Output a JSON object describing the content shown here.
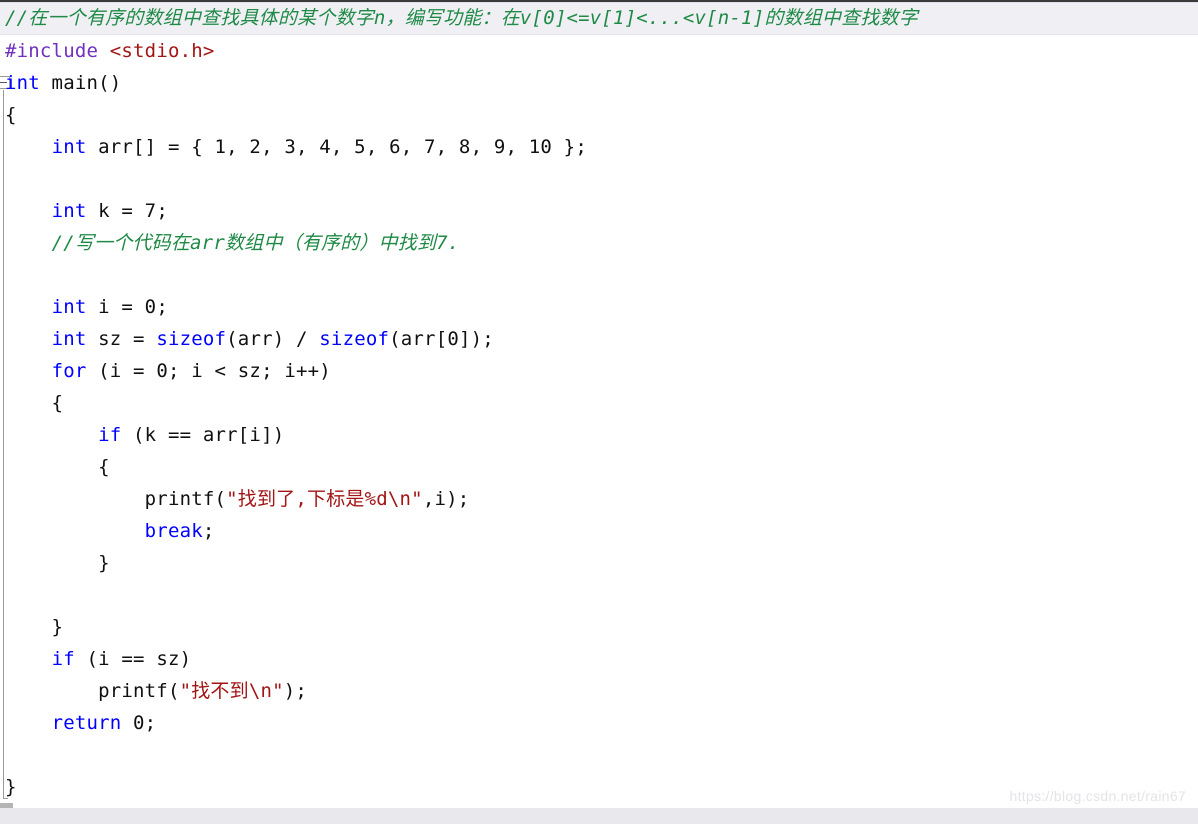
{
  "app": {
    "type": "code-editor",
    "language": "C",
    "watermark": "https://blog.csdn.net/rain67"
  },
  "colors": {
    "background": "#ffffff",
    "text": "#101010",
    "keyword": "#0000ff",
    "preprocessor": "#7030c0",
    "header": "#a31515",
    "string": "#a31515",
    "comment": "#1f8a46",
    "highlight_line": "#f0f0f4",
    "bottom_strip": "#e8e8ed",
    "watermark": "#e4e4e8"
  },
  "gutter": {
    "fold_box_icon": "collapse-minus-icon",
    "fold_box_line_index": 2
  },
  "code": {
    "lines": [
      {
        "i": 0,
        "highlight": true,
        "text": "//在一个有序的数组中查找具体的某个数字n，编写功能：在v[0]<=v[1]<...<v[n-1]的数组中查找数字",
        "tokens": [
          {
            "t": "//在一个有序的数组中查找具体的某个数字n，编写功能：在v[0]<=v[1]<...<v[n-1]的数组中查找数字",
            "c": "cmt"
          }
        ]
      },
      {
        "i": 1,
        "highlight": false,
        "text": "#include <stdio.h>",
        "tokens": [
          {
            "t": "#include ",
            "c": "pre"
          },
          {
            "t": "<stdio.h>",
            "c": "hdr"
          }
        ]
      },
      {
        "i": 2,
        "highlight": false,
        "text": "int main()",
        "tokens": [
          {
            "t": "int",
            "c": "kw"
          },
          {
            "t": " main()",
            "c": "pun"
          }
        ]
      },
      {
        "i": 3,
        "highlight": false,
        "text": "{",
        "tokens": [
          {
            "t": "{",
            "c": "pun"
          }
        ]
      },
      {
        "i": 4,
        "highlight": false,
        "text": "    int arr[] = { 1, 2, 3, 4, 5, 6, 7, 8, 9, 10 };",
        "tokens": [
          {
            "t": "    ",
            "c": "pun"
          },
          {
            "t": "int",
            "c": "kw"
          },
          {
            "t": " arr[] = { 1, 2, 3, 4, 5, 6, 7, 8, 9, 10 };",
            "c": "pun"
          }
        ]
      },
      {
        "i": 5,
        "highlight": false,
        "text": "",
        "tokens": []
      },
      {
        "i": 6,
        "highlight": false,
        "text": "    int k = 7;",
        "tokens": [
          {
            "t": "    ",
            "c": "pun"
          },
          {
            "t": "int",
            "c": "kw"
          },
          {
            "t": " k = 7;",
            "c": "pun"
          }
        ]
      },
      {
        "i": 7,
        "highlight": false,
        "text": "    //写一个代码在arr数组中（有序的）中找到7.",
        "tokens": [
          {
            "t": "    ",
            "c": "pun"
          },
          {
            "t": "//写一个代码在arr数组中（有序的）中找到7.",
            "c": "cmt"
          }
        ]
      },
      {
        "i": 8,
        "highlight": false,
        "text": "",
        "tokens": []
      },
      {
        "i": 9,
        "highlight": false,
        "text": "    int i = 0;",
        "tokens": [
          {
            "t": "    ",
            "c": "pun"
          },
          {
            "t": "int",
            "c": "kw"
          },
          {
            "t": " i = 0;",
            "c": "pun"
          }
        ]
      },
      {
        "i": 10,
        "highlight": false,
        "text": "    int sz = sizeof(arr) / sizeof(arr[0]);",
        "tokens": [
          {
            "t": "    ",
            "c": "pun"
          },
          {
            "t": "int",
            "c": "kw"
          },
          {
            "t": " sz = ",
            "c": "pun"
          },
          {
            "t": "sizeof",
            "c": "kw"
          },
          {
            "t": "(arr) / ",
            "c": "pun"
          },
          {
            "t": "sizeof",
            "c": "kw"
          },
          {
            "t": "(arr[0]);",
            "c": "pun"
          }
        ]
      },
      {
        "i": 11,
        "highlight": false,
        "text": "    for (i = 0; i < sz; i++)",
        "tokens": [
          {
            "t": "    ",
            "c": "pun"
          },
          {
            "t": "for",
            "c": "kw"
          },
          {
            "t": " (i = 0; i < sz; i++)",
            "c": "pun"
          }
        ]
      },
      {
        "i": 12,
        "highlight": false,
        "text": "    {",
        "tokens": [
          {
            "t": "    {",
            "c": "pun"
          }
        ]
      },
      {
        "i": 13,
        "highlight": false,
        "text": "        if (k == arr[i])",
        "tokens": [
          {
            "t": "        ",
            "c": "pun"
          },
          {
            "t": "if",
            "c": "kw"
          },
          {
            "t": " (k == arr[i])",
            "c": "pun"
          }
        ]
      },
      {
        "i": 14,
        "highlight": false,
        "text": "        {",
        "tokens": [
          {
            "t": "        {",
            "c": "pun"
          }
        ]
      },
      {
        "i": 15,
        "highlight": false,
        "text": "            printf(\"找到了,下标是%d\\n\",i);",
        "tokens": [
          {
            "t": "            printf(",
            "c": "pun"
          },
          {
            "t": "\"找到了,下标是%d\\n\"",
            "c": "str"
          },
          {
            "t": ",i);",
            "c": "pun"
          }
        ]
      },
      {
        "i": 16,
        "highlight": false,
        "text": "            break;",
        "tokens": [
          {
            "t": "            ",
            "c": "pun"
          },
          {
            "t": "break",
            "c": "kw"
          },
          {
            "t": ";",
            "c": "pun"
          }
        ]
      },
      {
        "i": 17,
        "highlight": false,
        "text": "        }",
        "tokens": [
          {
            "t": "        }",
            "c": "pun"
          }
        ]
      },
      {
        "i": 18,
        "highlight": false,
        "text": "",
        "tokens": []
      },
      {
        "i": 19,
        "highlight": false,
        "text": "    }",
        "tokens": [
          {
            "t": "    }",
            "c": "pun"
          }
        ]
      },
      {
        "i": 20,
        "highlight": false,
        "text": "    if (i == sz)",
        "tokens": [
          {
            "t": "    ",
            "c": "pun"
          },
          {
            "t": "if",
            "c": "kw"
          },
          {
            "t": " (i == sz)",
            "c": "pun"
          }
        ]
      },
      {
        "i": 21,
        "highlight": false,
        "text": "        printf(\"找不到\\n\");",
        "tokens": [
          {
            "t": "        printf(",
            "c": "pun"
          },
          {
            "t": "\"找不到\\n\"",
            "c": "str"
          },
          {
            "t": ");",
            "c": "pun"
          }
        ]
      },
      {
        "i": 22,
        "highlight": false,
        "text": "    return 0;",
        "tokens": [
          {
            "t": "    ",
            "c": "pun"
          },
          {
            "t": "return",
            "c": "kw"
          },
          {
            "t": " 0;",
            "c": "pun"
          }
        ]
      },
      {
        "i": 23,
        "highlight": false,
        "text": "",
        "tokens": []
      },
      {
        "i": 24,
        "highlight": false,
        "text": "}",
        "tokens": [
          {
            "t": "}",
            "c": "pun"
          }
        ]
      }
    ]
  }
}
